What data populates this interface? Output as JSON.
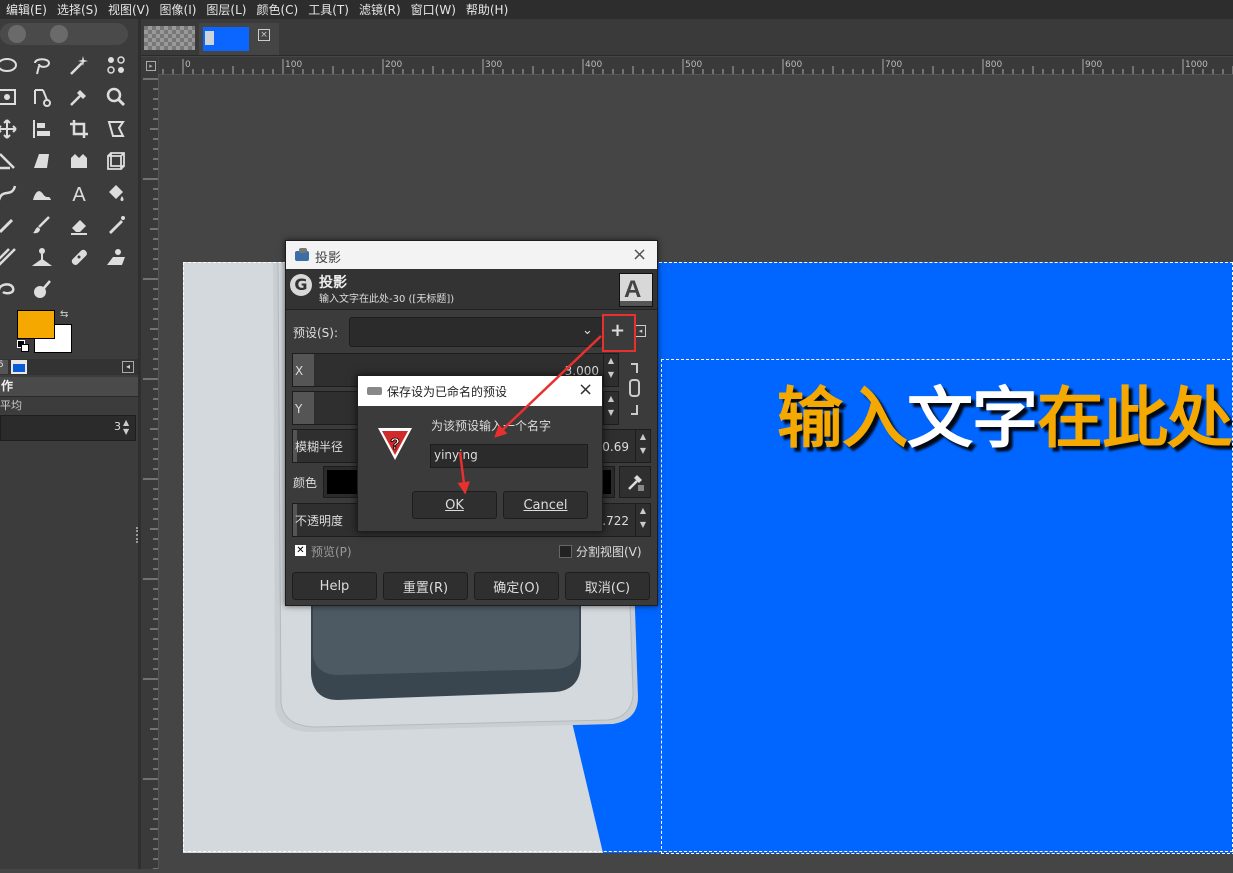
{
  "menu": [
    "编辑(E)",
    "选择(S)",
    "视图(V)",
    "图像(I)",
    "图层(L)",
    "颜色(C)",
    "工具(T)",
    "滤镜(R)",
    "窗口(W)",
    "帮助(H)"
  ],
  "toolbox": {
    "fg_color": "#f5a800",
    "bg_color": "#ffffff",
    "panel_title": "作",
    "panel_mode": "平均",
    "panel_value": "3"
  },
  "ruler": {
    "h_labels": [
      "0",
      "100",
      "200",
      "300",
      "400",
      "500",
      "600",
      "700",
      "800",
      "900",
      "1000"
    ]
  },
  "canvas": {
    "headline_part1": "输入",
    "headline_part2": "文字",
    "headline_part3": "在此处",
    "blue": "#0066ff",
    "orange": "#f5a800"
  },
  "shadow_dialog": {
    "window_title": "投影",
    "header_title": "投影",
    "header_subtitle": "输入文字在此处-30 ([无标题])",
    "presets_label": "预设(S):",
    "x_label": "X",
    "x_value": "3.000",
    "y_label": "Y",
    "blur_label": "模糊半径",
    "blur_value": "0.69",
    "color_label": "颜色",
    "opacity_label": "不透明度",
    "opacity_value": "1.722",
    "preview_label": "预览(P)",
    "split_label": "分割视图(V)",
    "help": "Help",
    "reset": "重置(R)",
    "ok": "确定(O)",
    "cancel": "取消(C)"
  },
  "save_dialog": {
    "title": "保存设为已命名的预设",
    "prompt": "为该预设输入一个名字",
    "input_value": "yinying",
    "ok": "OK",
    "cancel": "Cancel"
  },
  "annotation_color": "#e8312f"
}
